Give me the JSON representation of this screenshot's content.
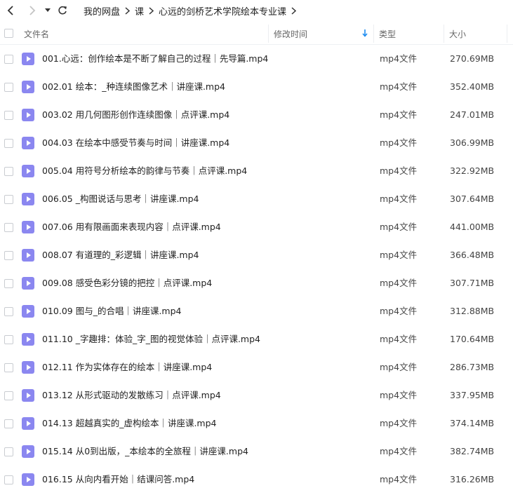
{
  "breadcrumb": [
    "我的网盘",
    "课",
    "心远的剑桥艺术学院绘本专业课"
  ],
  "columns": {
    "name": "文件名",
    "modified": "修改时间",
    "type": "类型",
    "size": "大小"
  },
  "colors": {
    "accent": "#1f8cf0",
    "video_icon": "#8b87f0"
  },
  "files": [
    {
      "name": "001.心远：创作绘本是不断了解自己的过程｜先导篇.mp4",
      "type": "mp4文件",
      "size": "270.69MB"
    },
    {
      "name": "002.01 绘本：_种连续图像艺术｜讲座课.mp4",
      "type": "mp4文件",
      "size": "352.40MB"
    },
    {
      "name": "003.02 用几何图形创作连续图像｜点评课.mp4",
      "type": "mp4文件",
      "size": "247.01MB"
    },
    {
      "name": "004.03 在绘本中感受节奏与时间｜讲座课.mp4",
      "type": "mp4文件",
      "size": "306.99MB"
    },
    {
      "name": "005.04 用符号分析绘本的韵律与节奏｜点评课.mp4",
      "type": "mp4文件",
      "size": "322.92MB"
    },
    {
      "name": "006.05 _构图说话与思考｜讲座课.mp4",
      "type": "mp4文件",
      "size": "307.64MB"
    },
    {
      "name": "007.06 用有限画面来表现内容｜点评课.mp4",
      "type": "mp4文件",
      "size": "441.00MB"
    },
    {
      "name": "008.07 有道理的_彩逻辑｜讲座课.mp4",
      "type": "mp4文件",
      "size": "366.48MB"
    },
    {
      "name": "009.08 感受色彩分镜的把控｜点评课.mp4",
      "type": "mp4文件",
      "size": "307.71MB"
    },
    {
      "name": "010.09 图与_的合唱｜讲座课.mp4",
      "type": "mp4文件",
      "size": "312.88MB"
    },
    {
      "name": "011.10 _字趣排：体验_字_图的视觉体验｜点评课.mp4",
      "type": "mp4文件",
      "size": "170.64MB"
    },
    {
      "name": "012.11 作为实体存在的绘本｜讲座课.mp4",
      "type": "mp4文件",
      "size": "286.73MB"
    },
    {
      "name": "013.12  从形式驱动的发散练习｜点评课.mp4",
      "type": "mp4文件",
      "size": "337.95MB"
    },
    {
      "name": "014.13 超越真实的_虚构绘本｜讲座课.mp4",
      "type": "mp4文件",
      "size": "374.14MB"
    },
    {
      "name": "015.14 从0到出版，_本绘本的全旅程｜讲座课.mp4",
      "type": "mp4文件",
      "size": "382.74MB"
    },
    {
      "name": "016.15 从向内看开始｜结课问答.mp4",
      "type": "mp4文件",
      "size": "316.26MB"
    }
  ]
}
